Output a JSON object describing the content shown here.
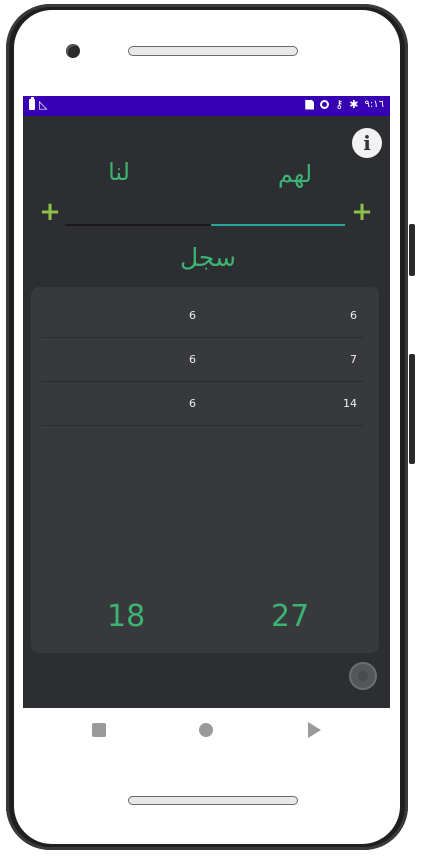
{
  "status_bar": {
    "time": "٩:١٦",
    "left_icons": [
      "battery-icon",
      "no-signal-icon"
    ],
    "right_icons": [
      "sim-card-icon",
      "data-saver-icon",
      "key-icon",
      "gear-icon"
    ]
  },
  "header": {
    "info_icon_label": "i"
  },
  "teams": {
    "them_label": "لهم",
    "us_label": "لنا",
    "add_label": "+"
  },
  "history": {
    "title": "سجل",
    "rows": [
      {
        "us": "6",
        "them": "6"
      },
      {
        "us": "6",
        "them": "7"
      },
      {
        "us": "6",
        "them": "14"
      }
    ],
    "total_us": "18",
    "total_them": "27"
  },
  "colors": {
    "status_bar": "#3700b3",
    "background": "#2d2e32",
    "card": "#38393d",
    "accent_green": "#3cb371",
    "plus_green": "#8bc34a",
    "underline_teal": "#26a69a"
  }
}
